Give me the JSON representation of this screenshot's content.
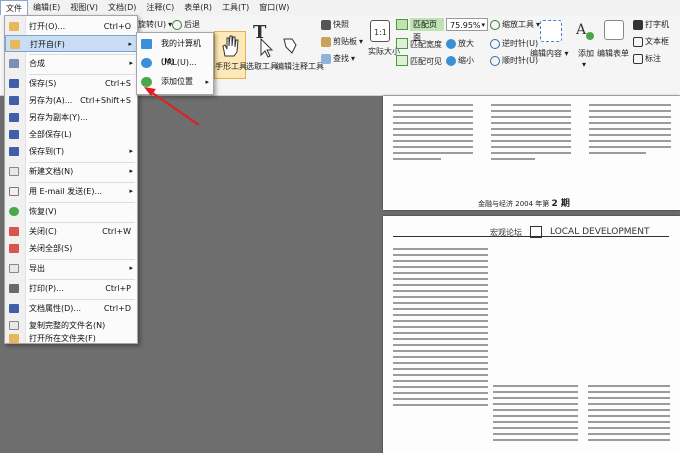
{
  "menubar": {
    "items": [
      "文件",
      "编辑(E)",
      "视图(V)",
      "文档(D)",
      "注释(C)",
      "表单(R)",
      "工具(T)",
      "窗口(W)"
    ]
  },
  "toolbar": {
    "rotate_label": "旋转(U)",
    "back_label": "后退",
    "hand_tool": "手形工具",
    "select_tool": "选取工具",
    "edit_comment_tool": "编辑注释工具",
    "snapshot": "快照",
    "clipboard": "剪贴板",
    "find": "查找",
    "actual_size": "实际大小",
    "fit_page": "匹配页面",
    "fit_width": "匹配宽度",
    "fit_visible": "匹配可见",
    "zoom_value": "75.95%",
    "zoom_tool": "缩放工具",
    "zoom_in": "放大",
    "zoom_out": "缩小",
    "rotate_ccw": "逆时针(U)",
    "rotate_cw": "顺时针(U)",
    "edit_content": "编辑内容",
    "add": "添加",
    "edit_form": "编辑表单",
    "typewriter": "打字机",
    "textbox": "文本框",
    "callout": "标注"
  },
  "file_menu": {
    "items": [
      {
        "label": "打开(O)...",
        "shortcut": "Ctrl+O",
        "submenu": false
      },
      {
        "label": "打开自(F)",
        "shortcut": "",
        "submenu": true
      },
      {
        "label": "合成",
        "shortcut": "",
        "submenu": true
      },
      {
        "label": "保存(S)",
        "shortcut": "Ctrl+S",
        "submenu": false
      },
      {
        "label": "另存为(A)...",
        "shortcut": "Ctrl+Shift+S",
        "submenu": false
      },
      {
        "label": "另存为副本(Y)...",
        "shortcut": "",
        "submenu": false
      },
      {
        "label": "全部保存(L)",
        "shortcut": "",
        "submenu": false
      },
      {
        "label": "保存到(T)",
        "shortcut": "",
        "submenu": true
      },
      {
        "label": "新建文档(N)",
        "shortcut": "",
        "submenu": true
      },
      {
        "label": "用 E-mail 发送(E)...",
        "shortcut": "",
        "submenu": true
      },
      {
        "label": "恢复(V)",
        "shortcut": "",
        "submenu": false
      },
      {
        "label": "关闭(C)",
        "shortcut": "Ctrl+W",
        "submenu": false
      },
      {
        "label": "关闭全部(S)",
        "shortcut": "",
        "submenu": false
      },
      {
        "label": "导出",
        "shortcut": "",
        "submenu": true
      },
      {
        "label": "打印(P)...",
        "shortcut": "Ctrl+P",
        "submenu": false
      },
      {
        "label": "文档属性(D)...",
        "shortcut": "Ctrl+D",
        "submenu": false
      },
      {
        "label": "复制完整的文件名(N)",
        "shortcut": "",
        "submenu": false
      },
      {
        "label": "打开所在文件夹(F)",
        "shortcut": "",
        "submenu": false
      }
    ]
  },
  "open_from_submenu": {
    "items": [
      {
        "label": "我的计算机(M)",
        "submenu": false
      },
      {
        "label": "URL(U)...",
        "submenu": false
      },
      {
        "label": "添加位置",
        "submenu": true
      }
    ]
  },
  "document": {
    "footer_text": "金融与经济",
    "footer_year": "2004 年第",
    "footer_issue": "2 期",
    "header_text": "LOCAL DEVELOPMENT",
    "header_cn": "宏观论坛"
  },
  "colors": {
    "highlight": "#fde9b8",
    "selected_menu": "#c9def5",
    "arrow": "#e02020"
  }
}
